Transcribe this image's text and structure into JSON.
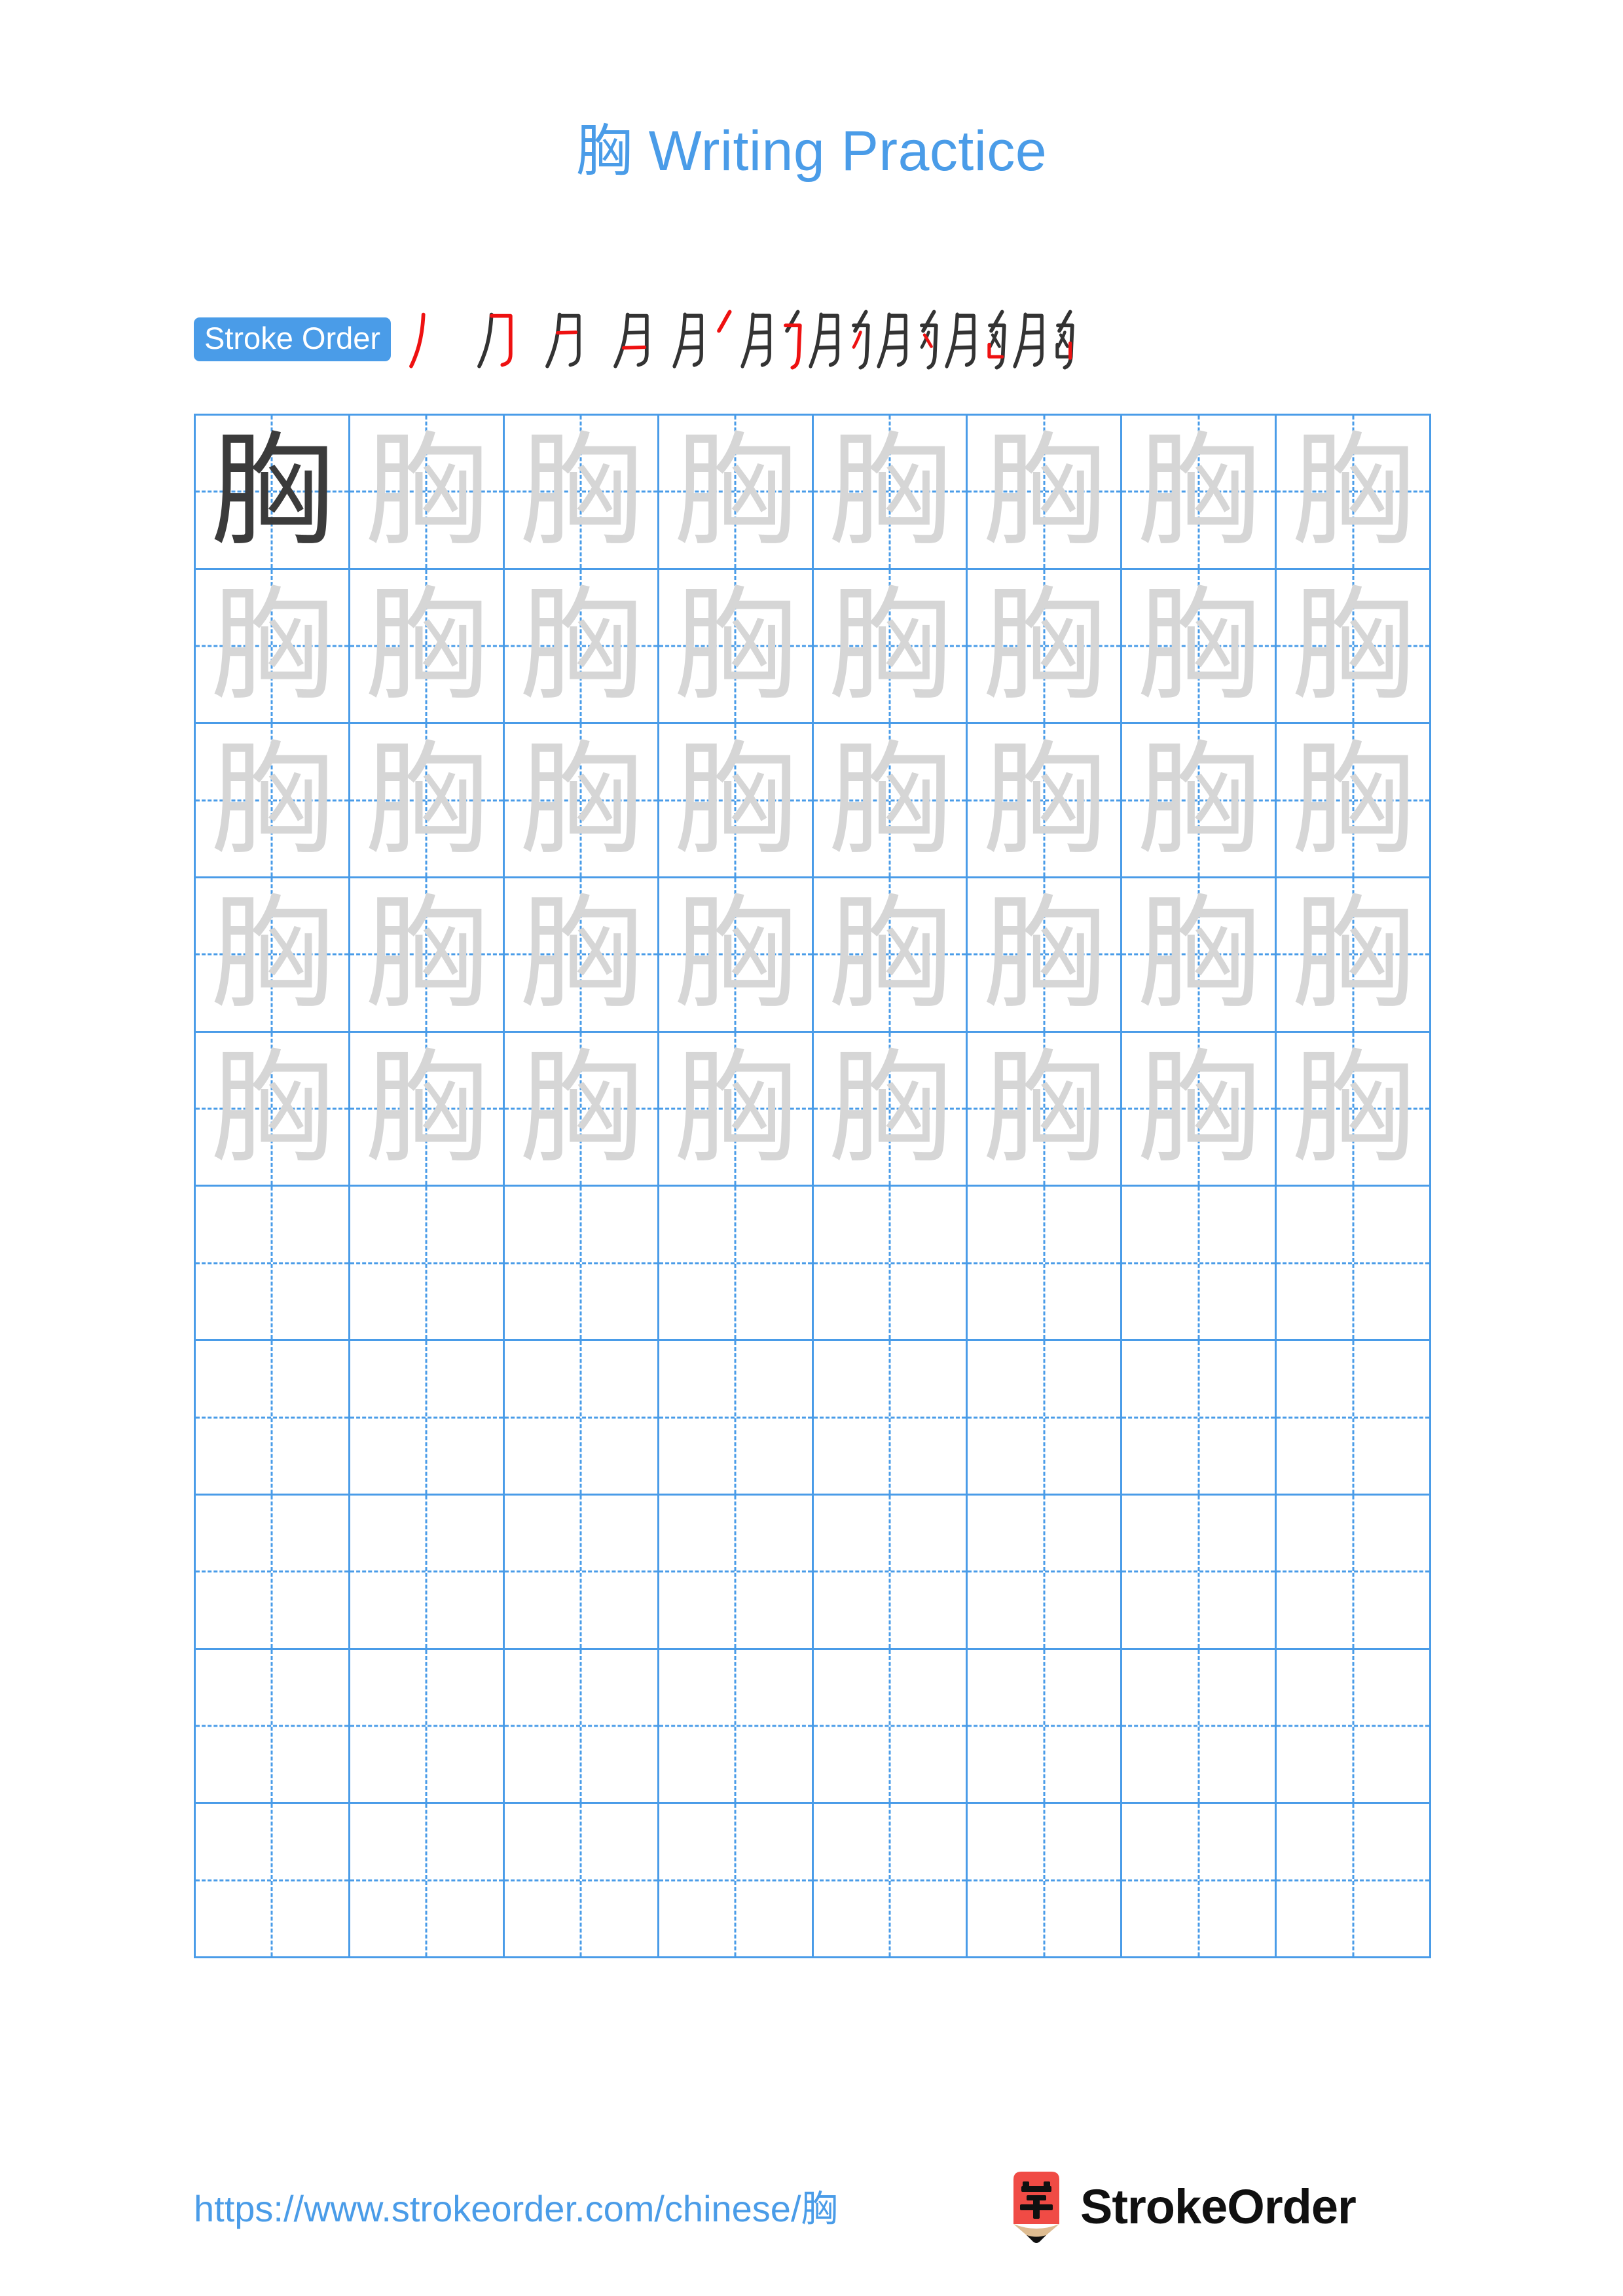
{
  "page": {
    "character": "胸",
    "background_color": "#ffffff",
    "accent_color": "#4a9ce8",
    "title": "胸 Writing Practice",
    "title_char": "胸",
    "title_text": " Writing Practice"
  },
  "stroke_order": {
    "badge_label": "Stroke Order",
    "badge_bg": "#4a9ce8",
    "badge_text_color": "#ffffff",
    "stroke_count": 10,
    "new_stroke_color": "#ee1111",
    "done_stroke_color": "#333333",
    "steps": [
      {
        "index": 1,
        "partial": "丿",
        "new_stroke": "丿 (piě) left-falling"
      },
      {
        "index": 2,
        "partial": "刀",
        "new_stroke": "横折钩 (héng zhé gōu)"
      },
      {
        "index": 3,
        "partial": "月",
        "new_stroke": "横 (héng) upper inner"
      },
      {
        "index": 4,
        "partial": "月",
        "new_stroke": "横 (héng) lower inner"
      },
      {
        "index": 5,
        "partial": "月丿",
        "new_stroke": "撇 (piě) of 勹"
      },
      {
        "index": 6,
        "partial": "肑",
        "new_stroke": "横折钩 (héng zhé gōu) of 勹"
      },
      {
        "index": 7,
        "partial": "肑",
        "new_stroke": "撇 (piě) in 凶"
      },
      {
        "index": 8,
        "partial": "胊",
        "new_stroke": "点 (diǎn) in 凶"
      },
      {
        "index": 9,
        "partial": "胸",
        "new_stroke": "竖 (shù) of 凵"
      },
      {
        "index": 10,
        "partial": "胸",
        "new_stroke": "竖折 / 竖 (shù) closing 凵"
      }
    ]
  },
  "practice_grid": {
    "columns": 8,
    "rows": 10,
    "line_color": "#4a9ce8",
    "guide_style": "dashed-cross",
    "dark_char_color": "#3b3b3b",
    "light_char_color": "#d6d6d6",
    "cells": [
      [
        "dark",
        "light",
        "light",
        "light",
        "light",
        "light",
        "light",
        "light"
      ],
      [
        "light",
        "light",
        "light",
        "light",
        "light",
        "light",
        "light",
        "light"
      ],
      [
        "light",
        "light",
        "light",
        "light",
        "light",
        "light",
        "light",
        "light"
      ],
      [
        "light",
        "light",
        "light",
        "light",
        "light",
        "light",
        "light",
        "light"
      ],
      [
        "light",
        "light",
        "light",
        "light",
        "light",
        "light",
        "light",
        "light"
      ],
      [
        "empty",
        "empty",
        "empty",
        "empty",
        "empty",
        "empty",
        "empty",
        "empty"
      ],
      [
        "empty",
        "empty",
        "empty",
        "empty",
        "empty",
        "empty",
        "empty",
        "empty"
      ],
      [
        "empty",
        "empty",
        "empty",
        "empty",
        "empty",
        "empty",
        "empty",
        "empty"
      ],
      [
        "empty",
        "empty",
        "empty",
        "empty",
        "empty",
        "empty",
        "empty",
        "empty"
      ],
      [
        "empty",
        "empty",
        "empty",
        "empty",
        "empty",
        "empty",
        "empty",
        "empty"
      ]
    ]
  },
  "footer": {
    "url_prefix": "https://www.strokeorder.com/chinese/",
    "url_char": "胸",
    "url_color": "#4a9ce8",
    "brand_name": "StrokeOrder",
    "logo_char": "字",
    "logo_body_color": "#f04b45",
    "logo_wood_color": "#debc91",
    "logo_tip_color": "#101010"
  }
}
